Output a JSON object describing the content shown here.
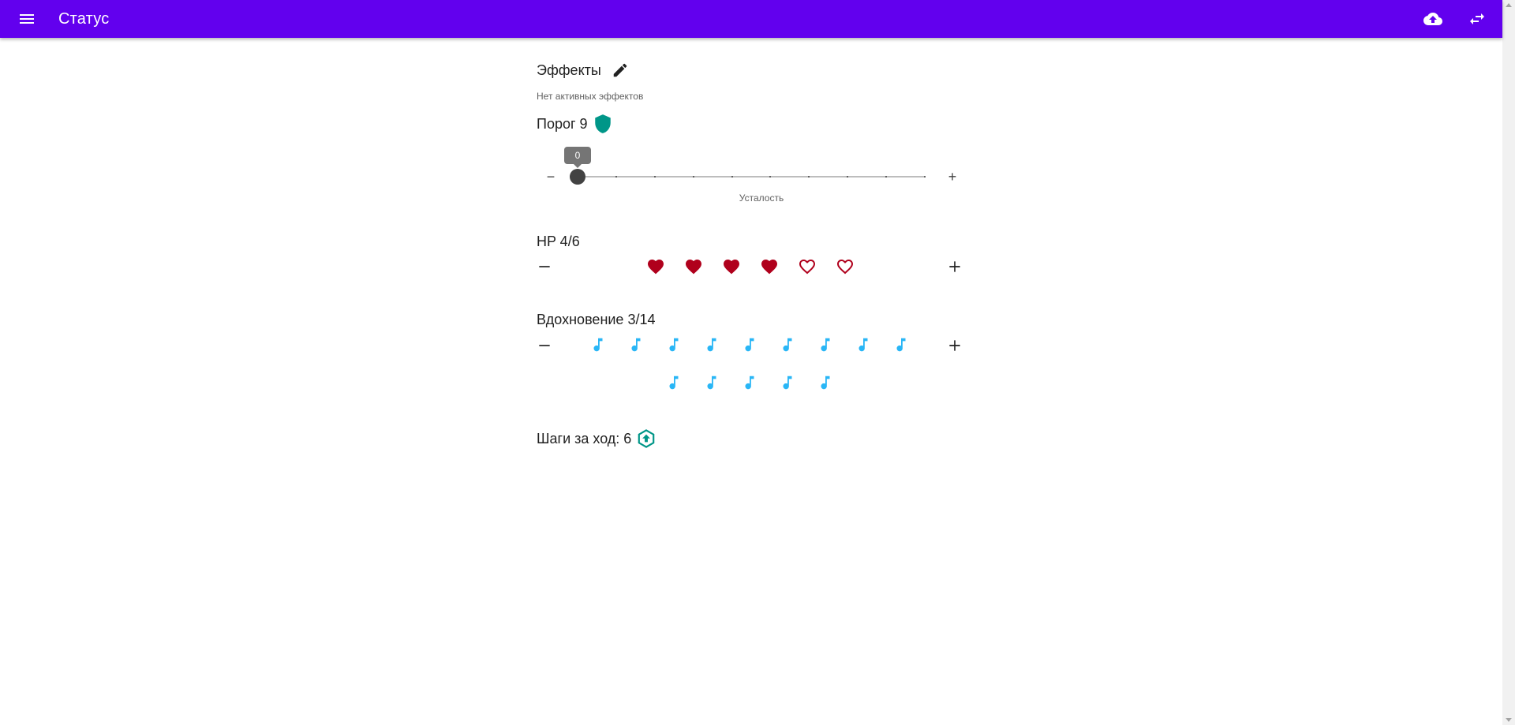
{
  "app_bar": {
    "title": "Статус",
    "icons": [
      "menu-icon",
      "cloud-upload-icon",
      "swap-icon"
    ],
    "color": "#6200ee"
  },
  "effects": {
    "title": "Эффекты",
    "subtitle": "Нет активных эффектов",
    "edit_icon": "pencil-icon"
  },
  "threshold": {
    "title": "Порог 9",
    "icon": "shield-icon",
    "icon_color": "#009688",
    "slider": {
      "value": 0,
      "tooltip": "0",
      "min": 0,
      "max": 9,
      "minus_label": "−",
      "plus_label": "+",
      "label": "Усталость"
    }
  },
  "hp": {
    "title": "HP 4/6",
    "current": 4,
    "max": 6,
    "filled_color": "#b0001c",
    "icon": "heart-icon"
  },
  "inspiration": {
    "title": "Вдохновение 3/14",
    "current": 3,
    "max": 14,
    "color": "#29b6f6",
    "icon": "music-note-icon"
  },
  "steps": {
    "title": "Шаги за ход: 6",
    "icon": "hexagon-arrow-up-icon",
    "icon_color": "#009688"
  }
}
